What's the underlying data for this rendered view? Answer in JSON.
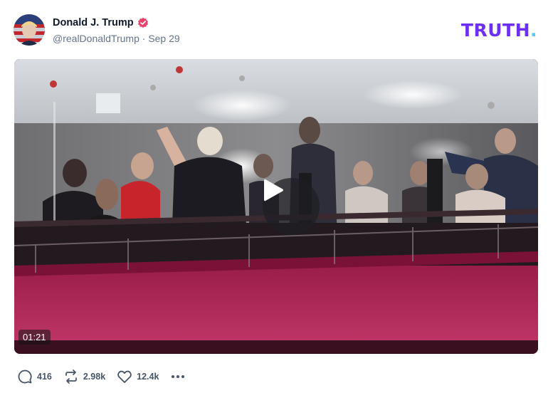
{
  "post": {
    "author_name": "Donald J. Trump",
    "handle": "@realDonaldTrump",
    "separator": "·",
    "date": "Sep 29"
  },
  "brand": {
    "logo_text": "TRUTH",
    "logo_dot": ".",
    "primary_color": "#6d2ff5",
    "dot_color": "#5ec8ee",
    "verified_color": "#e8416b"
  },
  "video": {
    "duration": "01:21"
  },
  "actions": {
    "replies": "416",
    "retruths": "2.98k",
    "likes": "12.4k"
  },
  "icons": [
    "verified-badge-icon",
    "play-icon",
    "reply-icon",
    "retruth-icon",
    "heart-icon",
    "more-options-icon"
  ]
}
